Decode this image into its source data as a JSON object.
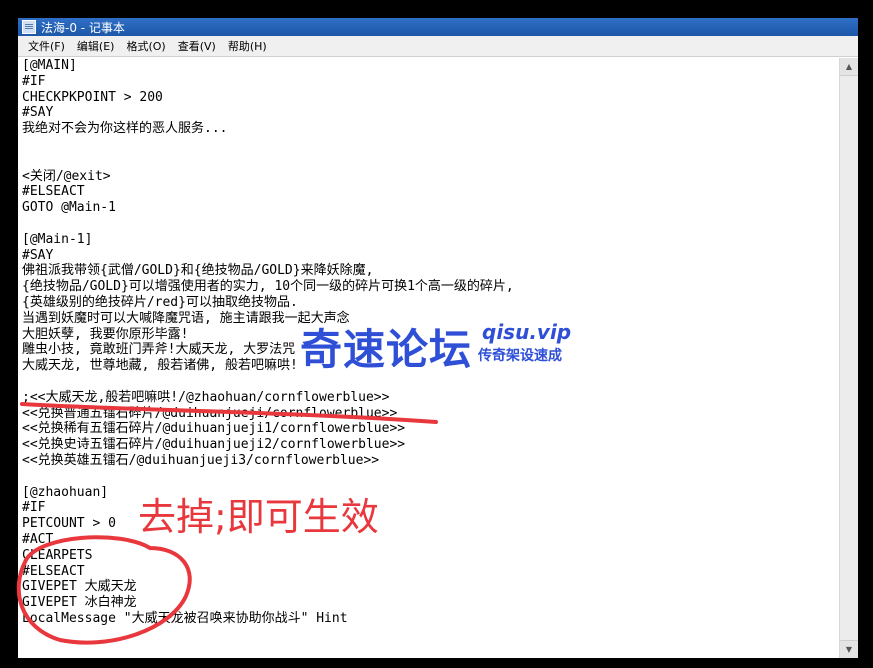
{
  "window": {
    "title": "法海-0 - 记事本",
    "menu": [
      "文件(F)",
      "编辑(E)",
      "格式(O)",
      "查看(V)",
      "帮助(H)"
    ]
  },
  "editor": {
    "lines": [
      "[@MAIN]",
      "#IF",
      "CHECKPKPOINT > 200",
      "#SAY",
      "我绝对不会为你这样的恶人服务...",
      "",
      "",
      "<关闭/@exit>",
      "#ELSEACT",
      "GOTO @Main-1",
      "",
      "[@Main-1]",
      "#SAY",
      "佛祖派我带领{武僧/GOLD}和{绝技物品/GOLD}来降妖除魔,",
      "{绝技物品/GOLD}可以增强使用者的实力, 10个同一级的碎片可换1个高一级的碎片,",
      "{英雄级别的绝技碎片/red}可以抽取绝技物品.",
      "当遇到妖魔时可以大喊降魔咒语, 施主请跟我一起大声念",
      "大胆妖孽, 我要你原形毕露!",
      "雕虫小技, 竟敢班门弄斧!大威天龙, 大罗法咒",
      "大威天龙, 世尊地藏, 般若诸佛, 般若吧嘛哄!",
      "",
      ";<<大威天龙,般若吧嘛哄!/@zhaohuan/cornflowerblue>>",
      "<<兑换普通五镭石碎片/@duihuanjueji/cornflowerblue>>",
      "<<兑换稀有五镭石碎片/@duihuanjueji1/cornflowerblue>>",
      "<<兑换史诗五镭石碎片/@duihuanjueji2/cornflowerblue>>",
      "<<兑换英雄五镭石/@duihuanjueji3/cornflowerblue>>",
      "",
      "[@zhaohuan]",
      "#IF",
      "PETCOUNT > 0",
      "#ACT",
      "CLEARPETS",
      "#ELSEACT",
      "GIVEPET 大威天龙",
      "GIVEPET 冰白神龙",
      "LocalMessage \"大威天龙被召唤来协助你战斗\" Hint"
    ]
  },
  "watermark": {
    "main": "奇速论坛",
    "url": "qisu.vip",
    "sub": "传奇架设速成"
  },
  "annotation": {
    "text": "去掉;即可生效",
    "color": "#e8383d"
  }
}
